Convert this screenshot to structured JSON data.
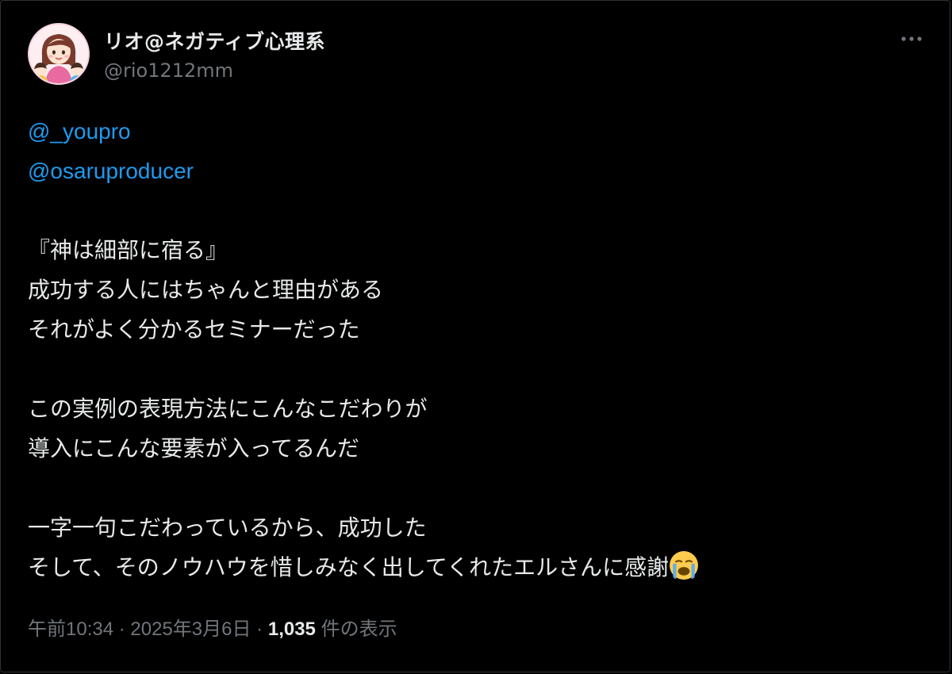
{
  "author": {
    "display_name": "リオ@ネガティブ心理系",
    "handle": "@rio1212mm"
  },
  "tweet": {
    "mentions": [
      "@_youpro",
      "@osaruproducer"
    ],
    "lines": [
      "『神は細部に宿る』",
      "成功する人にはちゃんと理由がある",
      "それがよく分かるセミナーだった",
      "",
      "この実例の表現方法にこんなこだわりが",
      "導入にこんな要素が入ってるんだ",
      "",
      "一字一句こだわっているから、成功した",
      "そして、そのノウハウを惜しみなく出してくれたエルさんに感謝"
    ],
    "emoji": "loudly-crying-face"
  },
  "meta": {
    "time": "午前10:34",
    "separator": "·",
    "date": "2025年3月6日",
    "views_count": "1,035",
    "views_label": "件の表示"
  },
  "icons": {
    "more": "more-horizontal-icon",
    "avatar": "avatar-illustration"
  },
  "colors": {
    "background": "#000000",
    "text": "#e7e9ea",
    "secondary": "#71767b",
    "link": "#1d9bf0"
  }
}
